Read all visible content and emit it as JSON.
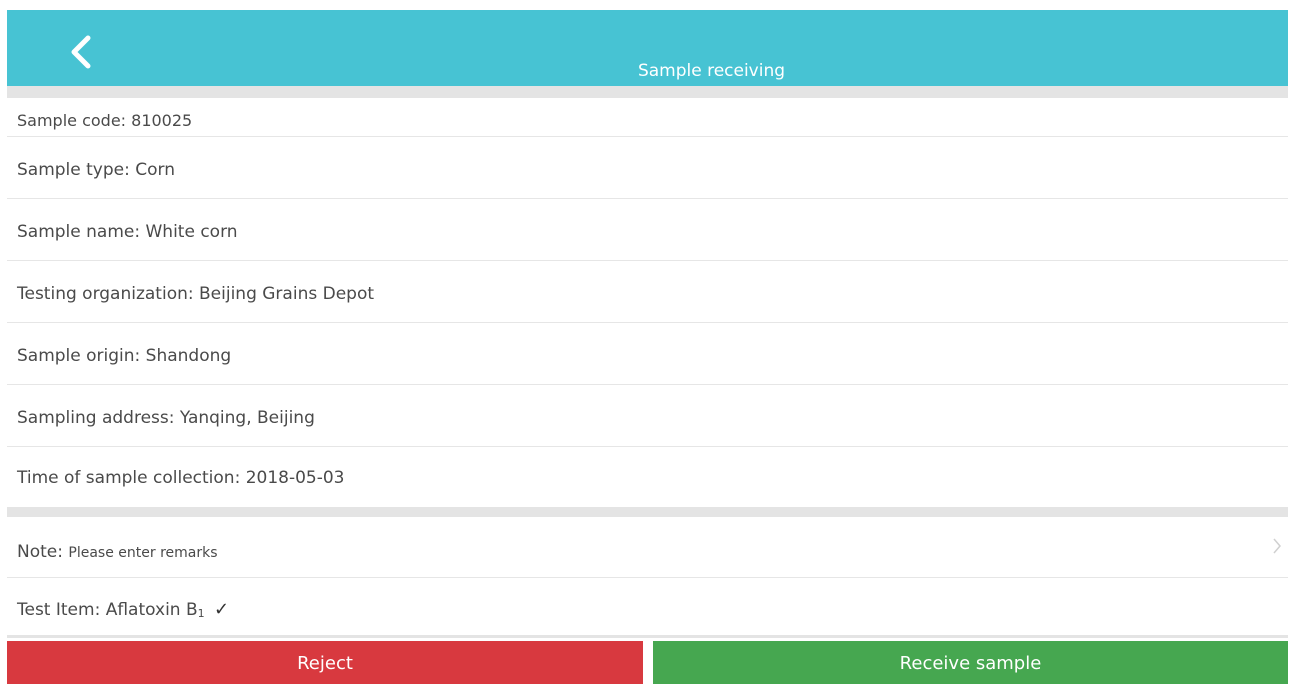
{
  "header": {
    "title": "Sample receiving",
    "back_icon": "chevron-left-icon",
    "color": "#47c3d3"
  },
  "details": {
    "sample_code": "Sample code: 810025",
    "sample_type": "Sample type: Corn",
    "sample_name": "Sample name: White corn",
    "testing_organization": "Testing organization: Beijing Grains Depot",
    "sample_origin": "Sample origin: Shandong",
    "sampling_address": "Sampling address: Yanqing, Beijing",
    "collection_time": "Time of sample collection: 2018-05-03"
  },
  "note": {
    "label": "Note:",
    "placeholder": "Please enter remarks",
    "arrow_icon": "chevron-right-icon"
  },
  "test_item": {
    "label": "Test Item: Aflatoxin B",
    "subscript": "1",
    "check": "✓"
  },
  "buttons": {
    "reject": "Reject",
    "receive": "Receive sample",
    "reject_color": "#d8393f",
    "receive_color": "#46a750"
  }
}
